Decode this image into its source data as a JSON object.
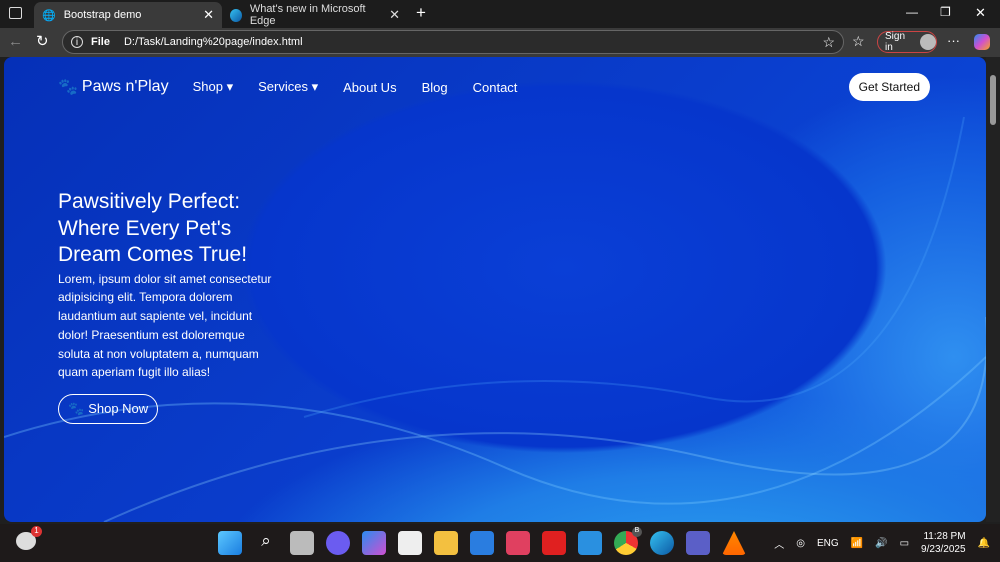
{
  "browser": {
    "tabs": [
      {
        "title": "Bootstrap demo",
        "active": true
      },
      {
        "title": "What's new in Microsoft Edge",
        "active": false
      }
    ],
    "url_label": "File",
    "url": "D:/Task/Landing%20page/index.html",
    "sign_in": "Sign in"
  },
  "nav": {
    "brand": "Paws n'Play",
    "items": [
      {
        "label": "Shop",
        "dropdown": true
      },
      {
        "label": "Services",
        "dropdown": true
      },
      {
        "label": "About Us"
      },
      {
        "label": "Blog"
      },
      {
        "label": "Contact"
      }
    ],
    "cta": "Get Started"
  },
  "hero": {
    "title": "Pawsitively Perfect: Where Every Pet's Dream Comes True!",
    "body": "Lorem, ipsum dolor sit amet consectetur adipisicing elit. Tempora dolorem laudantium aut sapiente vel, incidunt dolor! Praesentium est doloremque soluta at non voluptatem a, numquam quam aperiam fugit illo alias!",
    "button": "Shop Now"
  },
  "taskbar": {
    "weather_badge": "1",
    "chrome_badge": "B",
    "lang": "ENG",
    "time": "11:28 PM",
    "date": "9/23/2025"
  }
}
